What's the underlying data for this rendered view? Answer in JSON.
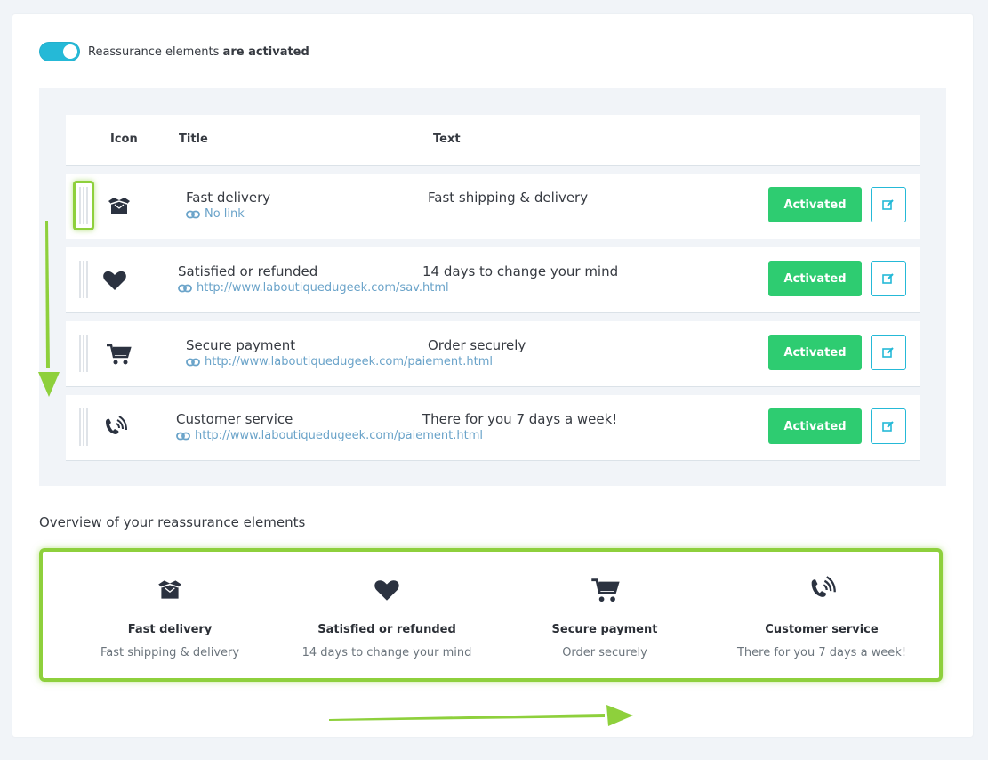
{
  "toggle": {
    "label_prefix": "Reassurance elements",
    "label_bold": "are activated",
    "state": "on"
  },
  "table": {
    "headers": {
      "icon": "Icon",
      "title": "Title",
      "text": "Text"
    },
    "rows": [
      {
        "icon": "box-icon",
        "title": "Fast delivery",
        "link": "No link",
        "text": "Fast shipping & delivery",
        "status": "Activated"
      },
      {
        "icon": "heart-icon",
        "title": "Satisfied or refunded",
        "link": "http://www.laboutiquedugeek.com/sav.html",
        "text": "14 days to change your mind",
        "status": "Activated"
      },
      {
        "icon": "cart-icon",
        "title": "Secure payment",
        "link": "http://www.laboutiquedugeek.com/paiement.html",
        "text": "Order securely",
        "status": "Activated"
      },
      {
        "icon": "phone-icon",
        "title": "Customer service",
        "link": "http://www.laboutiquedugeek.com/paiement.html",
        "text": "There for you 7 days a week!",
        "status": "Activated"
      }
    ]
  },
  "overview": {
    "title": "Overview of your reassurance elements",
    "items": [
      {
        "icon": "box-icon",
        "title": "Fast delivery",
        "text": "Fast shipping & delivery"
      },
      {
        "icon": "heart-icon",
        "title": "Satisfied or refunded",
        "text": "14 days to change your mind"
      },
      {
        "icon": "cart-icon",
        "title": "Secure payment",
        "text": "Order securely"
      },
      {
        "icon": "phone-icon",
        "title": "Customer service",
        "text": "There for you 7 days a week!"
      }
    ]
  },
  "colors": {
    "accent": "#25b9d7",
    "success": "#2ecc71",
    "highlight": "#8ed03c",
    "link": "#6aa3c9"
  }
}
